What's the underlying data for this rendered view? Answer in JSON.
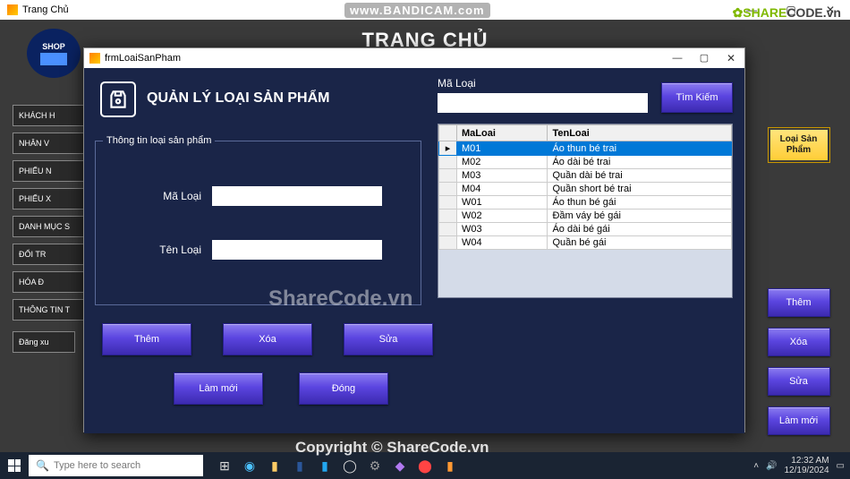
{
  "watermark": {
    "bandicam": "www.BANDICAM.com",
    "sharecode": "SHARECODE.vn",
    "center": "ShareCode.vn",
    "copyright": "Copyright © ShareCode.vn"
  },
  "main_window": {
    "title": "Trang Chủ",
    "header": "TRANG CHỦ",
    "logo_text": "SHOP",
    "sidebar": [
      "KHÁCH H",
      "NHÂN V",
      "PHIẾU N",
      "PHIẾU X",
      "DANH MỤC S",
      "ĐỔI TR",
      "HÓA Đ",
      "THÔNG TIN T"
    ],
    "logout": "Đăng xu",
    "right_gold": "Loại Sản Phẩm",
    "right_buttons": [
      "Thêm",
      "Xóa",
      "Sửa",
      "Làm mới"
    ]
  },
  "modal": {
    "title": "frmLoaiSanPham",
    "heading": "QUẢN LÝ LOẠI SẢN PHẨM",
    "fieldset_legend": "Thông tin loại sản phẩm",
    "labels": {
      "ma": "Mã Loại",
      "ten": "Tên Loại",
      "search": "Mã Loại"
    },
    "inputs": {
      "ma": "",
      "ten": "",
      "search": ""
    },
    "buttons": {
      "them": "Thêm",
      "xoa": "Xóa",
      "sua": "Sửa",
      "lammoi": "Làm mới",
      "dong": "Đóng",
      "timkiem": "Tìm Kiếm"
    },
    "grid": {
      "columns": [
        "MaLoai",
        "TenLoai"
      ],
      "rows": [
        {
          "ma": "M01",
          "ten": "Áo thun bé trai",
          "sel": true
        },
        {
          "ma": "M02",
          "ten": "Áo dài bé trai"
        },
        {
          "ma": "M03",
          "ten": "Quần dài bé trai"
        },
        {
          "ma": "M04",
          "ten": "Quần short bé trai"
        },
        {
          "ma": "W01",
          "ten": "Áo thun bé gái"
        },
        {
          "ma": "W02",
          "ten": "Đầm váy bé gái"
        },
        {
          "ma": "W03",
          "ten": "Áo dài bé gái"
        },
        {
          "ma": "W04",
          "ten": "Quần bé gái"
        }
      ]
    }
  },
  "taskbar": {
    "search_placeholder": "Type here to search",
    "time": "12:32 AM",
    "date": "12/19/2024"
  }
}
